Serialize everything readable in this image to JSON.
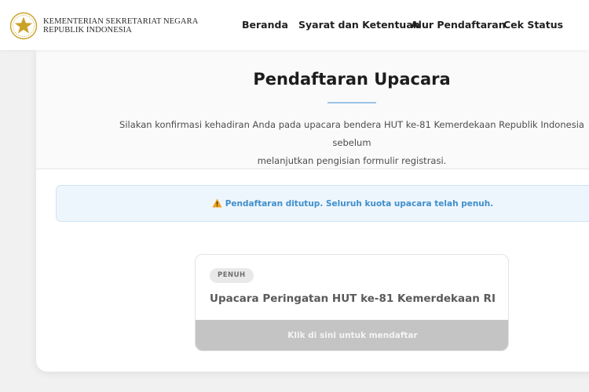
{
  "header": {
    "org_line1": "KEMENTERIAN SEKRETARIAT NEGARA",
    "org_line2": "REPUBLIK INDONESIA",
    "logo_icon": "garuda-emblem-icon",
    "logo_color": "#c9a227",
    "nav": [
      {
        "label": "Beranda"
      },
      {
        "label": "Syarat dan Ketentuan"
      },
      {
        "label": "Alur Pendaftaran"
      },
      {
        "label": "Cek Status"
      }
    ]
  },
  "main": {
    "title": "Pendaftaran Upacara",
    "intro_line1": "Silakan konfirmasi kehadiran Anda pada upacara bendera HUT ke-81 Kemerdekaan Republik Indonesia sebelum",
    "intro_line2": "melanjutkan pengisian formulir registrasi.",
    "accent_color": "#9cc3e6"
  },
  "alert": {
    "icon": "warning-icon",
    "message": "Pendaftaran ditutup. Seluruh kuota upacara telah penuh.",
    "text_color": "#3f8fcc"
  },
  "event": {
    "badge": "PENUH",
    "title": "Upacara Peringatan HUT ke-81 Kemerdekaan RI",
    "button_label": "Klik di sini untuk mendaftar",
    "button_color": "#c4c4c4"
  }
}
